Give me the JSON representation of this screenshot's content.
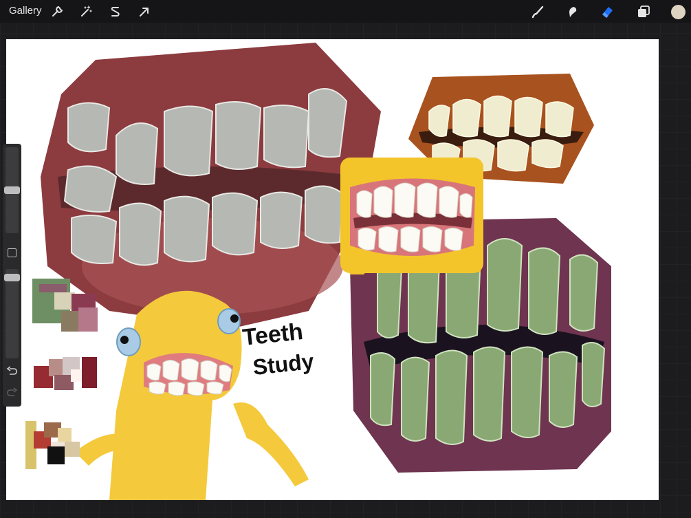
{
  "toolbar": {
    "gallery_label": "Gallery",
    "left_icons": [
      "wrench-icon",
      "magic-wand-icon",
      "selection-s-icon",
      "transform-arrow-icon"
    ],
    "right_icons": [
      "brush-icon",
      "smudge-icon",
      "eraser-icon",
      "layers-icon",
      "color-swatch"
    ],
    "active_tool": "eraser",
    "accent_color": "#1e6ff5",
    "current_color": "#dcd3c0"
  },
  "sidebar": {
    "brush_size_level": 0.62,
    "opacity_level": 0.07
  },
  "canvas": {
    "handwritten_title": "Teeth Study"
  }
}
